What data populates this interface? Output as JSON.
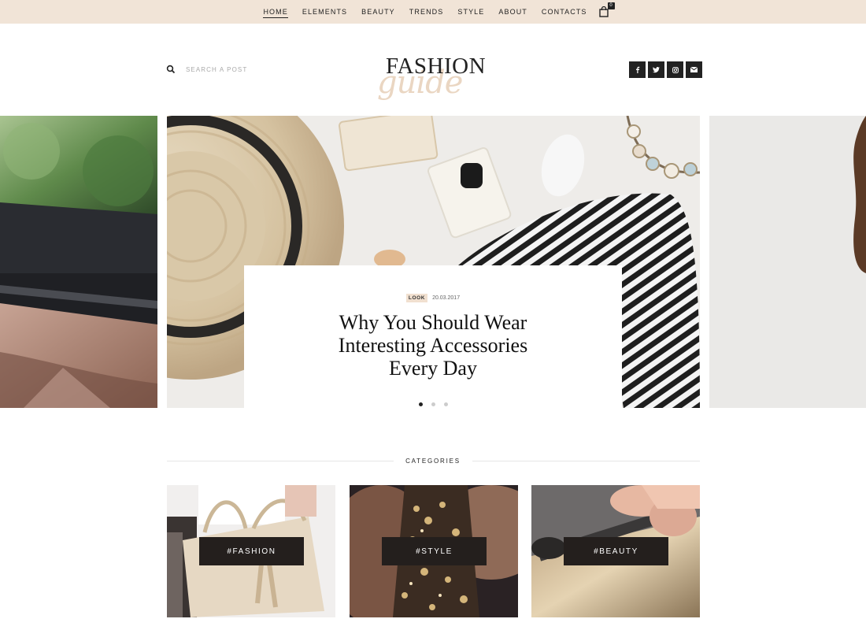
{
  "nav": {
    "items": [
      {
        "label": "HOME",
        "active": true
      },
      {
        "label": "ELEMENTS",
        "active": false
      },
      {
        "label": "BEAUTY",
        "active": false
      },
      {
        "label": "TRENDS",
        "active": false
      },
      {
        "label": "STYLE",
        "active": false
      },
      {
        "label": "ABOUT",
        "active": false
      },
      {
        "label": "CONTACTS",
        "active": false
      }
    ],
    "cart_count": "0",
    "cart_icon": "shopping-bag-icon"
  },
  "header": {
    "search_placeholder": "SEARCH A POST",
    "logo_main": "FASHION",
    "logo_script": "guide",
    "social": [
      {
        "icon": "facebook-icon",
        "glyph": "f"
      },
      {
        "icon": "twitter-icon",
        "glyph": "t"
      },
      {
        "icon": "instagram-icon",
        "glyph": "i"
      },
      {
        "icon": "mail-icon",
        "glyph": "m"
      }
    ]
  },
  "slider": {
    "tag": "LOOK",
    "date": "20.03.2017",
    "headline": "Why You Should Wear\nInteresting Accessories\nEvery Day",
    "dots": 3,
    "active_dot": 0
  },
  "categories": {
    "heading": "CATEGORIES",
    "items": [
      {
        "label": "#FASHION"
      },
      {
        "label": "#STYLE"
      },
      {
        "label": "#BEAUTY"
      }
    ]
  },
  "colors": {
    "topbar": "#f1e4d7",
    "accent_tag": "#f1e0d0",
    "dark": "#241f1d"
  }
}
